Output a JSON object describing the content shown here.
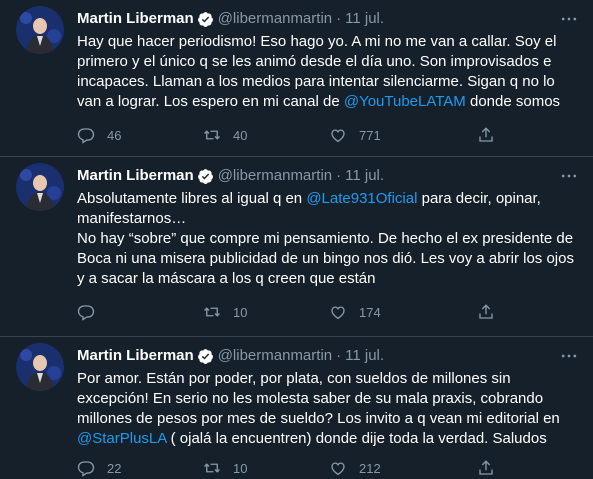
{
  "tweets": [
    {
      "author_name": "Martin Liberman",
      "handle": "@libermanmartin",
      "date": "11 jul.",
      "text_parts": [
        "Hay que hacer periodismo! Eso hago yo. A mi no me van a callar. Soy el primero y el único q se les animó desde el día uno. Son improvisados e incapaces. Llaman a los medios para intentar silenciarme. Sigan q no lo van a lograr. Los espero en mi canal de ",
        "@YouTubeLATAM",
        " donde somos"
      ],
      "replies": "46",
      "retweets": "40",
      "likes": "771"
    },
    {
      "author_name": "Martin Liberman",
      "handle": "@libermanmartin",
      "date": "11 jul.",
      "text_parts": [
        "Absolutamente libres al igual q en ",
        "@Late931Oficial",
        " para decir, opinar, manifestarnos…\nNo hay “sobre” que compre mi pensamiento. De hecho el ex presidente de Boca ni una misera publicidad de un bingo nos dió. Les voy a abrir los ojos y a sacar la máscara a los q creen que están"
      ],
      "replies": "",
      "retweets": "10",
      "likes": "174"
    },
    {
      "author_name": "Martin Liberman",
      "handle": "@libermanmartin",
      "date": "11 jul.",
      "text_parts": [
        "Por amor. Están por poder, por plata, con sueldos de millones sin excepción! En serio no les molesta saber de su mala praxis, cobrando millones de pesos por mes de sueldo? Los invito a q vean mi editorial en\n",
        "@StarPlusLA",
        " ( ojalá la encuentren) donde dije toda la verdad. Saludos"
      ],
      "replies": "22",
      "retweets": "10",
      "likes": "212"
    }
  ],
  "icons": {
    "verified": "verified-badge-icon",
    "more": "more-options-icon",
    "reply": "reply-icon",
    "retweet": "retweet-icon",
    "like": "like-icon",
    "share": "share-icon"
  },
  "colors": {
    "background": "#15202b",
    "link": "#1d9bf0",
    "secondary_text": "#8899a6",
    "divider": "#38444d"
  }
}
